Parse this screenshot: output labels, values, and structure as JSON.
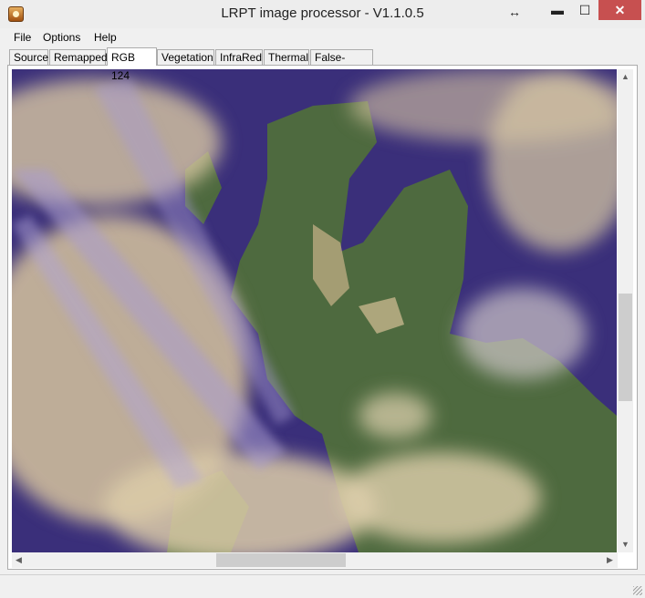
{
  "window": {
    "title": "LRPT image processor - V1.1.0.5",
    "resize_arrow": "↔",
    "minimize_glyph": "▬",
    "maximize_glyph": "☐",
    "close_glyph": "✕"
  },
  "menu": {
    "file": "File",
    "options": "Options",
    "help": "Help"
  },
  "tabs": [
    {
      "label": "Source"
    },
    {
      "label": "Remapped"
    },
    {
      "label": "RGB 124"
    },
    {
      "label": "Vegetation"
    },
    {
      "label": "InfraRed"
    },
    {
      "label": "Thermal"
    },
    {
      "label": "False-colour"
    }
  ],
  "active_tab": "RGB 124",
  "scrollbars": {
    "up": "▲",
    "down": "▼",
    "left": "◀",
    "right": "▶",
    "vertical_position": 0.47,
    "horizontal_position": 0.34
  },
  "image": {
    "description_icon": "satellite-image",
    "colors": {
      "sea": "#3a2f7a",
      "land": "#4e6a3f",
      "cloud": "#d8c7a3",
      "haze": "#a79ad0"
    }
  }
}
